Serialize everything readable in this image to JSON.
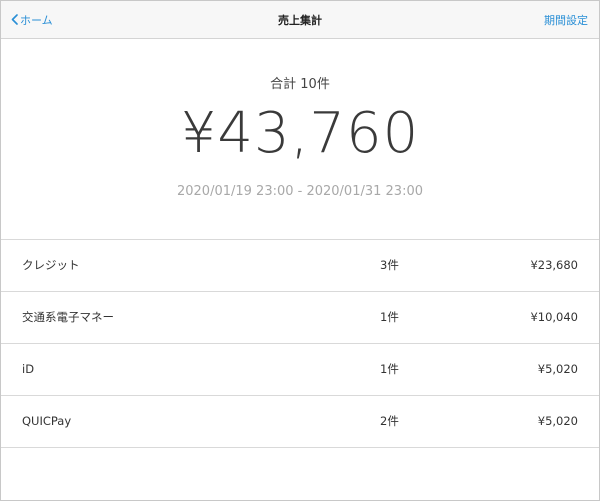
{
  "nav": {
    "back_label": "ホーム",
    "title": "売上集計",
    "right_label": "期間設定"
  },
  "summary": {
    "count_label": "合計 10件",
    "amount": "¥43,760",
    "date_range": "2020/01/19 23:00 - 2020/01/31 23:00"
  },
  "rows": [
    {
      "method": "クレジット",
      "count": "3件",
      "amount": "¥23,680"
    },
    {
      "method": "交通系電子マネー",
      "count": "1件",
      "amount": "¥10,040"
    },
    {
      "method": "iD",
      "count": "1件",
      "amount": "¥5,020"
    },
    {
      "method": "QUICPay",
      "count": "2件",
      "amount": "¥5,020"
    }
  ],
  "colors": {
    "accent": "#2a8fd6",
    "navbar_bg": "#f7f7f7",
    "muted_text": "#a8a8a8"
  }
}
